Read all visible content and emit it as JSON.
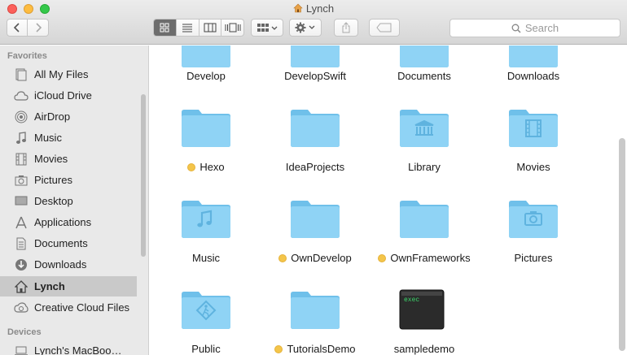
{
  "window": {
    "title": "Lynch"
  },
  "toolbar": {
    "search_placeholder": "Search",
    "icons": [
      "chevron-left-icon",
      "chevron-right-icon",
      "icon-view-icon",
      "list-view-icon",
      "column-view-icon",
      "coverflow-view-icon",
      "arrange-icon",
      "gear-icon",
      "share-icon",
      "tag-icon",
      "search-icon"
    ]
  },
  "sidebar": {
    "favorites_header": "Favorites",
    "devices_header": "Devices",
    "items": [
      {
        "label": "All My Files",
        "icon": "all-files-icon"
      },
      {
        "label": "iCloud Drive",
        "icon": "cloud-icon"
      },
      {
        "label": "AirDrop",
        "icon": "airdrop-icon"
      },
      {
        "label": "Music",
        "icon": "music-note-icon"
      },
      {
        "label": "Movies",
        "icon": "film-icon"
      },
      {
        "label": "Pictures",
        "icon": "camera-icon"
      },
      {
        "label": "Desktop",
        "icon": "desktop-icon"
      },
      {
        "label": "Applications",
        "icon": "applications-icon"
      },
      {
        "label": "Documents",
        "icon": "document-icon"
      },
      {
        "label": "Downloads",
        "icon": "download-icon"
      },
      {
        "label": "Lynch",
        "icon": "home-icon",
        "selected": true
      },
      {
        "label": "Creative Cloud Files",
        "icon": "creative-cloud-icon"
      }
    ],
    "devices": [
      {
        "label": "Lynch's MacBoo…",
        "icon": "laptop-icon"
      }
    ]
  },
  "files": [
    {
      "name": "Develop",
      "tagged": false,
      "kind": "folder"
    },
    {
      "name": "DevelopSwift",
      "tagged": false,
      "kind": "folder"
    },
    {
      "name": "Documents",
      "tagged": false,
      "kind": "folder"
    },
    {
      "name": "Downloads",
      "tagged": false,
      "kind": "folder"
    },
    {
      "name": "Hexo",
      "tagged": true,
      "kind": "folder"
    },
    {
      "name": "IdeaProjects",
      "tagged": false,
      "kind": "folder"
    },
    {
      "name": "Library",
      "tagged": false,
      "kind": "library"
    },
    {
      "name": "Movies",
      "tagged": false,
      "kind": "movies"
    },
    {
      "name": "Music",
      "tagged": false,
      "kind": "music"
    },
    {
      "name": "OwnDevelop",
      "tagged": true,
      "kind": "folder"
    },
    {
      "name": "OwnFrameworks",
      "tagged": true,
      "kind": "folder"
    },
    {
      "name": "Pictures",
      "tagged": false,
      "kind": "pictures"
    },
    {
      "name": "Public",
      "tagged": false,
      "kind": "public"
    },
    {
      "name": "TutorialsDemo",
      "tagged": true,
      "kind": "folder"
    },
    {
      "name": "sampledemo",
      "tagged": false,
      "kind": "exec",
      "exec_label": "exec"
    }
  ],
  "colors": {
    "folder": "#8fd3f5",
    "folder_dark": "#6fc0ea",
    "tag_yellow": "#f4c54a",
    "selected": "#c9c9c9"
  }
}
